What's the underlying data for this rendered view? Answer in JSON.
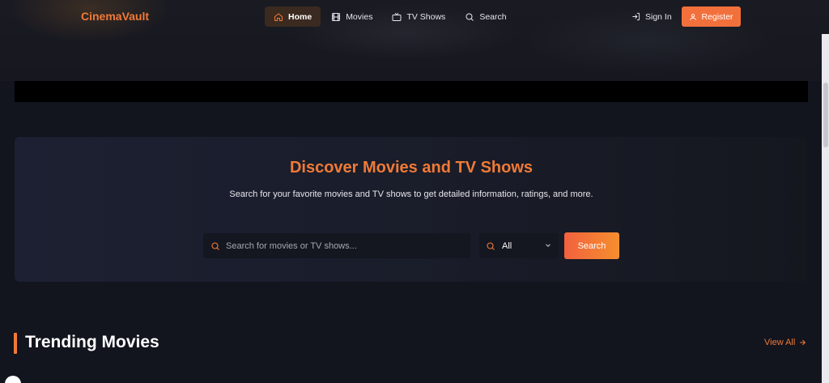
{
  "brand": {
    "name": "CinemaVault",
    "accent": "#f07a36"
  },
  "nav": {
    "links": [
      {
        "label": "Home",
        "icon": "home-icon",
        "active": true
      },
      {
        "label": "Movies",
        "icon": "film-icon",
        "active": false
      },
      {
        "label": "TV Shows",
        "icon": "tv-icon",
        "active": false
      },
      {
        "label": "Search",
        "icon": "search-icon",
        "active": false
      }
    ],
    "signin_label": "Sign In",
    "register_label": "Register"
  },
  "discover": {
    "title": "Discover Movies and TV Shows",
    "subtitle": "Search for your favorite movies and TV shows to get detailed information, ratings, and more.",
    "search_placeholder": "Search for movies or TV shows...",
    "search_value": "",
    "type_selected": "All",
    "search_button": "Search"
  },
  "trending": {
    "title": "Trending Movies",
    "view_all": "View All"
  }
}
